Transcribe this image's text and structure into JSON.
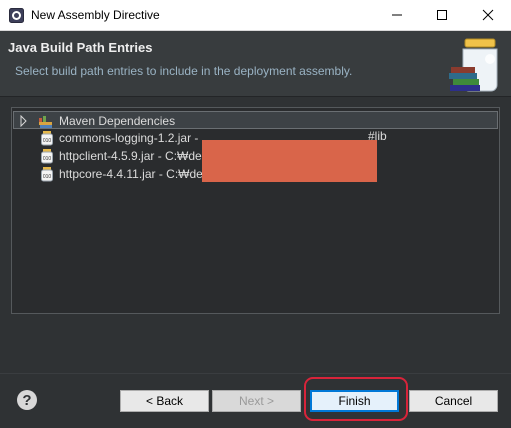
{
  "window": {
    "title": "New Assembly Directive",
    "icon": "eclipse-app-icon"
  },
  "header": {
    "title": "Java Build Path Entries",
    "subtitle": "Select build path entries to include in the deployment assembly.",
    "art_icon": "jar-library-banner-icon"
  },
  "tree": {
    "items": [
      {
        "label": "Maven Dependencies",
        "icon": "library-icon",
        "expandable": true,
        "selected": true
      },
      {
        "label": "commons-logging-1.2.jar - ",
        "icon": "jar-icon",
        "suffix": "#lib"
      },
      {
        "label": "httpclient-4.5.9.jar - C:₩de",
        "icon": "jar-icon"
      },
      {
        "label": "httpcore-4.4.11.jar - C:₩de",
        "icon": "jar-icon"
      }
    ],
    "redacted": true
  },
  "buttons": {
    "back": "< Back",
    "next": "Next >",
    "finish": "Finish",
    "cancel": "Cancel",
    "help": "?"
  },
  "colors": {
    "redaction": "#d9654a",
    "highlight_ring": "#d8243a",
    "default_button_border": "#0078d7"
  }
}
